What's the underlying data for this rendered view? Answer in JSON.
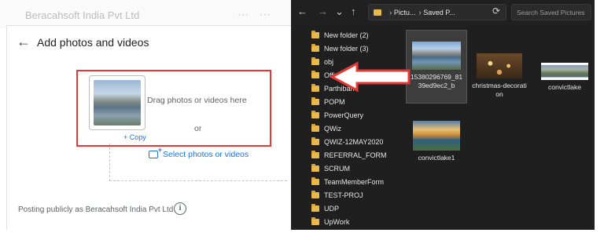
{
  "background_page": {
    "title": "Beracahsoft India Pvt Ltd"
  },
  "dialog": {
    "title": "Add photos and videos",
    "drag_text": "Drag photos or videos here",
    "or_text": "or",
    "copy_badge": "+ Copy",
    "select_link": "Select photos or videos",
    "posting_text": "Posting publicly as Beracahsoft India Pvt Ltd",
    "info_icon": "i"
  },
  "explorer": {
    "back": "←",
    "forward": "→",
    "recent": "⌄",
    "up": "↑",
    "address_parts": [
      "Pictu...",
      "Saved P..."
    ],
    "search_placeholder": "Search Saved Pictures",
    "folders": [
      "New folder (2)",
      "New folder (3)",
      "obj",
      "Office",
      "Parthiban",
      "POPM",
      "PowerQuery",
      "QWiz",
      "QWIZ-12MAY2020",
      "REFERRAL_FORM",
      "SCRUM",
      "TeamMemberForm",
      "TEST-PROJ",
      "UDP",
      "UpWork"
    ],
    "files": [
      {
        "name": "15380296769_8139ed9ec2_b",
        "selected": true
      },
      {
        "name": "christmas-decoration",
        "selected": false
      },
      {
        "name": "convictlake",
        "selected": false
      },
      {
        "name": "convictlake1",
        "selected": false
      }
    ]
  },
  "colors": {
    "highlight_red": "#e53935",
    "link_blue": "#1a73e8",
    "explorer_bg": "#1f1f1f",
    "folder_yellow": "#e8b84a"
  }
}
